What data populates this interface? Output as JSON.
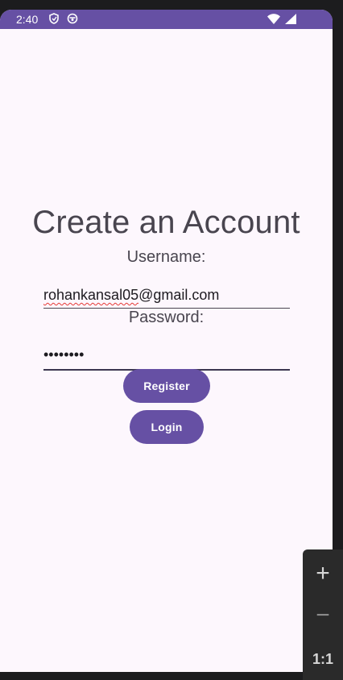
{
  "status_bar": {
    "time": "2:40",
    "left_icons": [
      "shield-icon",
      "app-notification-icon"
    ],
    "right_icons": [
      "wifi-icon",
      "cell-signal-icon"
    ],
    "color": "#6650a4"
  },
  "screen": {
    "title": "Create an Account",
    "username": {
      "label": "Username:",
      "value": "rohankansal05@gmail.com",
      "value_underlined_part": "rohankansal05",
      "value_rest": "@gmail.com"
    },
    "password": {
      "label": "Password:",
      "masked_value": "••••••••"
    },
    "register_button": "Register",
    "login_button": "Login"
  },
  "zoom_controls": {
    "zoom_in": "+",
    "zoom_out": "−",
    "reset": "1:1"
  },
  "colors": {
    "accent": "#6650a4",
    "background": "#fdf7fd",
    "text": "#49454f"
  }
}
